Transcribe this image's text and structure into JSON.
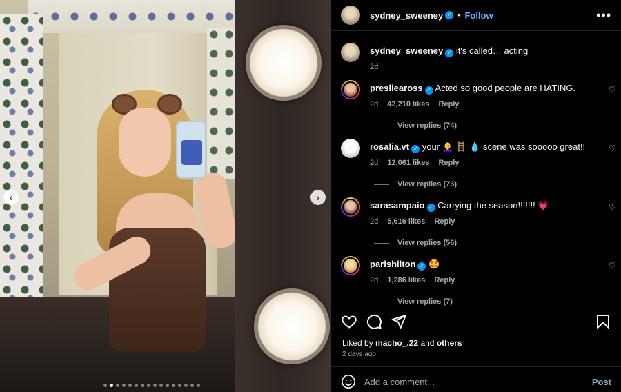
{
  "post": {
    "author": "sydney_sweeney",
    "follow_label": "Follow",
    "header_separator": "•",
    "more_label": "•••",
    "caption": {
      "username": "sydney_sweeney",
      "text": "it's called… acting",
      "time": "2d"
    },
    "carousel": {
      "prev_label": "‹",
      "next_label": "›",
      "total_slides": 16,
      "active_slide": 2
    }
  },
  "comments": [
    {
      "username": "preslieaross",
      "text": "Acted so good people are HATING.",
      "time": "2d",
      "likes": "42,210 likes",
      "reply_label": "Reply",
      "view_replies": "View replies (74)"
    },
    {
      "username": "rosalia.vt",
      "text": "your 👩‍🦲 🪜 💧 scene was sooooo great!!",
      "time": "2d",
      "likes": "12,061 likes",
      "reply_label": "Reply",
      "view_replies": "View replies (73)"
    },
    {
      "username": "sarasampaio",
      "text": "Carrying the season!!!!!!! 💗",
      "time": "2d",
      "likes": "5,616 likes",
      "reply_label": "Reply",
      "view_replies": "View replies (56)"
    },
    {
      "username": "parishilton",
      "text": "🤩",
      "time": "2d",
      "likes": "1,286 likes",
      "reply_label": "Reply",
      "view_replies": "View replies (7)"
    }
  ],
  "engagement": {
    "liked_by_prefix": "Liked by",
    "liked_by_user": "macho_.22",
    "liked_by_and": "and",
    "liked_by_others": "others",
    "posted_ago": "2 days ago"
  },
  "composer": {
    "placeholder": "Add a comment...",
    "post_label": "Post"
  },
  "colors": {
    "verified": "#0095f6",
    "follow": "#6ea7ff",
    "post_disabled": "#8fa6c9"
  },
  "icons": [
    "more-options-icon",
    "verified-badge-icon",
    "heart-icon",
    "comment-icon",
    "share-icon",
    "bookmark-icon",
    "emoji-icon",
    "chevron-left-icon",
    "chevron-right-icon"
  ]
}
